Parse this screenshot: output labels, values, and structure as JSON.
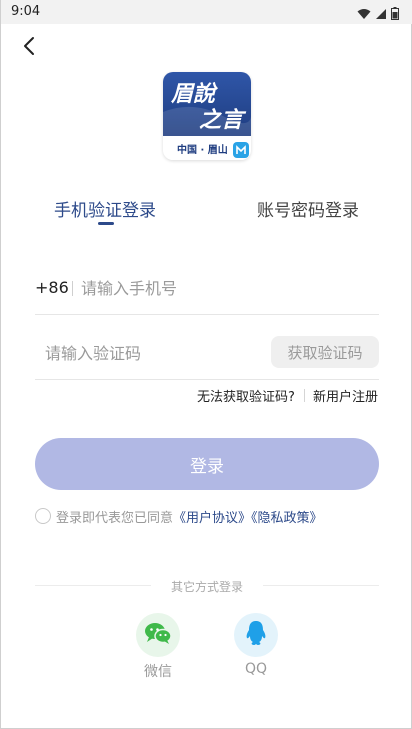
{
  "status_bar": {
    "time": "9:04",
    "icons": [
      "wifi-icon",
      "signal-icon",
      "battery-icon"
    ]
  },
  "header": {
    "back_icon": "chevron-left-icon"
  },
  "logo": {
    "title_line1": "眉說",
    "title_line2": "之言",
    "subtitle": "中国 · 眉山",
    "colors": {
      "primary": "#2d4a8a"
    }
  },
  "tabs": [
    {
      "label": "手机验证登录",
      "active": true
    },
    {
      "label": "账号密码登录",
      "active": false
    }
  ],
  "phone": {
    "country_code": "+86",
    "placeholder": "请输入手机号",
    "value": ""
  },
  "code": {
    "placeholder": "请输入验证码",
    "value": "",
    "get_code_label": "获取验证码"
  },
  "help": {
    "no_code": "无法获取验证码?",
    "register": "新用户注册"
  },
  "login": {
    "label": "登录",
    "color": "#b1b8e4"
  },
  "agreement": {
    "prefix": "登录即代表您已同意",
    "user_agreement": "《用户协议》",
    "privacy_policy": "《隐私政策》"
  },
  "other_login": {
    "title": "其它方式登录",
    "options": [
      {
        "label": "微信",
        "icon": "wechat-icon",
        "color": "#3fb94a"
      },
      {
        "label": "QQ",
        "icon": "qq-icon",
        "color": "#1fa0e8"
      }
    ]
  }
}
